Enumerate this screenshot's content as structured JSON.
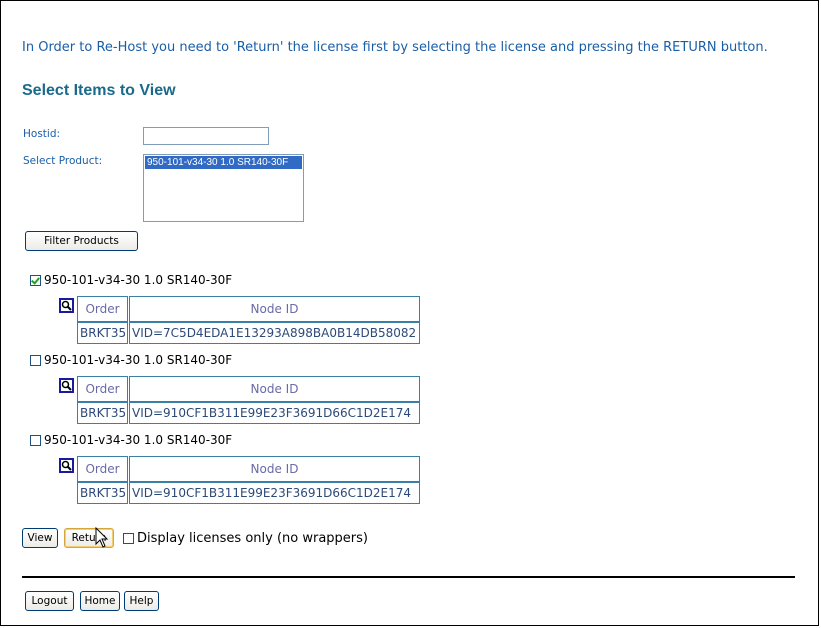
{
  "instruction": "In Order to Re-Host you need to 'Return' the license first by selecting the license and pressing the RETURN button.",
  "section_title": "Select Items to View",
  "form": {
    "hostid_label": "Hostid:",
    "hostid_value": "",
    "product_label": "Select Product:",
    "product_options": [
      "950-101-v34-30 1.0 SR140-30F"
    ],
    "filter_button": "Filter Products"
  },
  "licenses": [
    {
      "label": "950-101-v34-30 1.0 SR140-30F",
      "checked": true,
      "order_header": "Order",
      "node_header": "Node ID",
      "order": "BRKT35",
      "node_id": "VID=7C5D4EDA1E13293A898BA0B14DB58082"
    },
    {
      "label": "950-101-v34-30 1.0 SR140-30F",
      "checked": false,
      "order_header": "Order",
      "node_header": "Node ID",
      "order": "BRKT35",
      "node_id": "VID=910CF1B311E99E23F3691D66C1D2E174"
    },
    {
      "label": "950-101-v34-30 1.0 SR140-30F",
      "checked": false,
      "order_header": "Order",
      "node_header": "Node ID",
      "order": "BRKT35",
      "node_id": "VID=910CF1B311E99E23F3691D66C1D2E174"
    }
  ],
  "actions": {
    "view": "View",
    "return": "Return",
    "display_only_label": "Display licenses only (no wrappers)"
  },
  "footer": {
    "logout": "Logout",
    "home": "Home",
    "help": "Help"
  },
  "icons": {
    "detail": "magnifier-icon",
    "cursor": "mouse-pointer-icon"
  },
  "colors": {
    "link_text": "#1a5ea8",
    "title": "#1a6a8a",
    "table_border": "#3a7fa7",
    "selected_option": "#316ac5"
  }
}
